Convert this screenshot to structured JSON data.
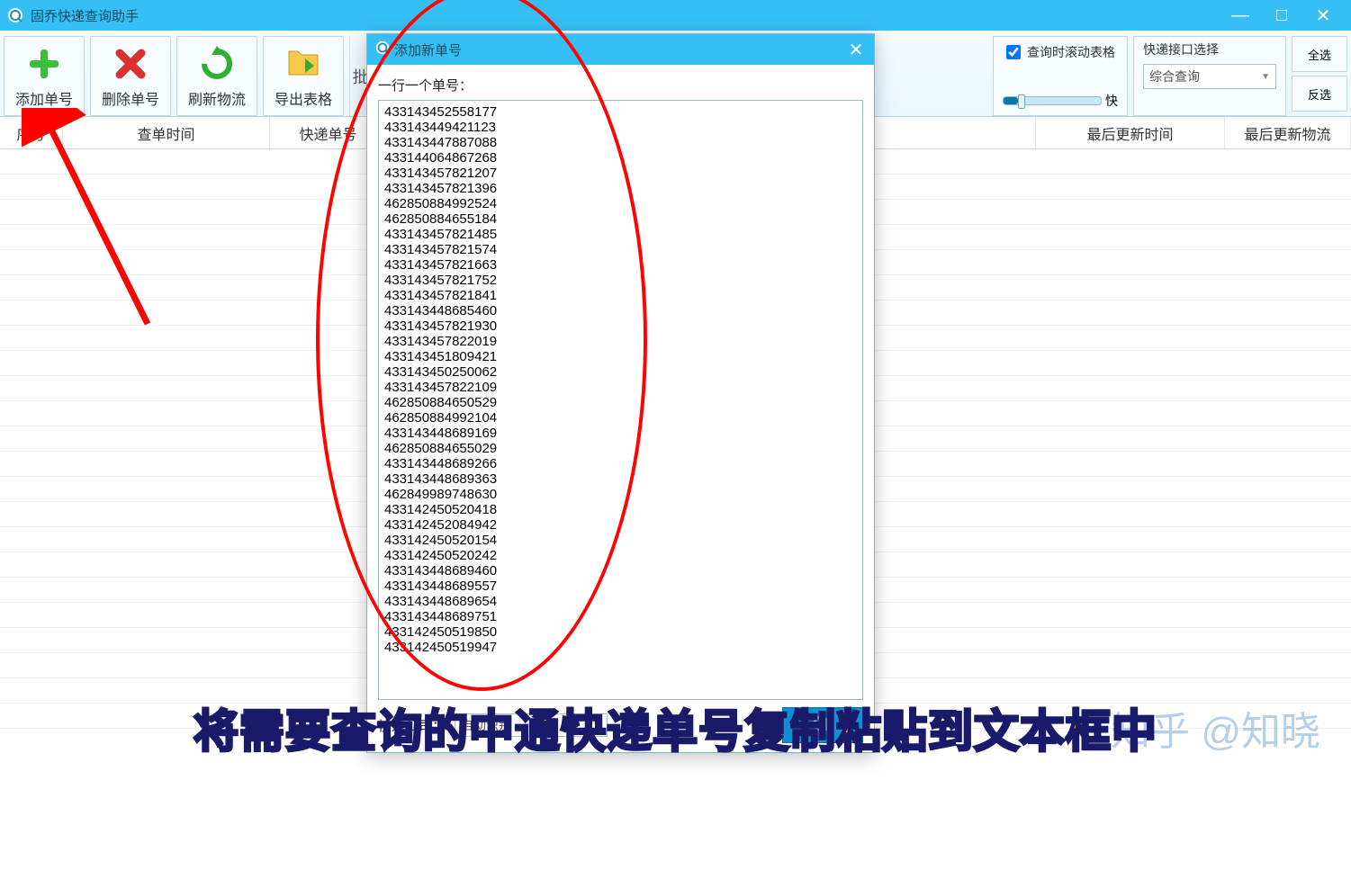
{
  "app": {
    "title": "固乔快递查询助手"
  },
  "window_buttons": {
    "min": "—",
    "max": "□",
    "close": "✕"
  },
  "toolbar": {
    "add": {
      "label": "添加单号"
    },
    "delete": {
      "label": "删除单号"
    },
    "refresh": {
      "label": "刷新物流"
    },
    "export": {
      "label": "导出表格"
    },
    "batch_cut": "批",
    "scroll_checkbox": "查询时滚动表格",
    "speed_label": "快",
    "iface_title": "快递接口选择",
    "iface_value": "综合查询",
    "select_all": "全选",
    "invert_sel": "反选"
  },
  "columns": {
    "seq": "序号",
    "query_time": "查单时间",
    "tracking_no": "快递单号",
    "last_update_time": "最后更新时间",
    "last_update_logi": "最后更新物流"
  },
  "modal": {
    "title": "添加新单号",
    "hint": "一行一个单号：",
    "company_label": "快递公司：",
    "company_value": "自动识别",
    "close": "✕",
    "numbers": [
      "433143452558177",
      "433143449421123",
      "433143447887088",
      "433144064867268",
      "433143457821207",
      "433143457821396",
      "462850884992524",
      "462850884655184",
      "433143457821485",
      "433143457821574",
      "433143457821663",
      "433143457821752",
      "433143457821841",
      "433143448685460",
      "433143457821930",
      "433143457822019",
      "433143451809421",
      "433143450250062",
      "433143457822109",
      "462850884650529",
      "462850884992104",
      "433143448689169",
      "462850884655029",
      "433143448689266",
      "433143448689363",
      "462849989748630",
      "433142450520418",
      "433142452084942",
      "433142450520154",
      "433142450520242",
      "433143448689460",
      "433143448689557",
      "433143448689654",
      "433143448689751",
      "433142450519850",
      "433142450519947"
    ]
  },
  "caption": "将需要查询的中通快递单号复制粘贴到文本框中",
  "watermark": "知乎 @知晓"
}
